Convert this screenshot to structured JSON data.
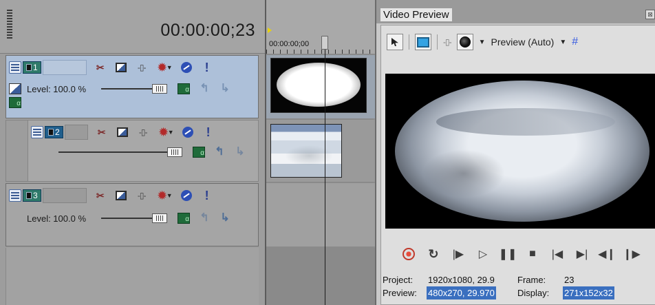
{
  "header": {
    "timecode": "00:00:00;23"
  },
  "tracks": [
    {
      "number": "1",
      "level_label": "Level: 100.0 %"
    },
    {
      "number": "2"
    },
    {
      "number": "3",
      "level_label": "Level: 100.0 %"
    }
  ],
  "timeline": {
    "ruler_time": "00:00:00;00"
  },
  "preview": {
    "title": "Video Preview",
    "close_glyph": "⊠",
    "quality_label": "Preview (Auto)",
    "info": {
      "project_label": "Project:",
      "project_value": "1920x1080, 29.9",
      "frame_label": "Frame:",
      "frame_value": "23",
      "preview_label": "Preview:",
      "preview_value": "480x270, 29.970",
      "display_label": "Display:",
      "display_value": "271x152x32"
    }
  },
  "colors": {
    "selected_track": "#adc0d9",
    "accent_blue": "#3a6fbf",
    "record_red": "#c0392b"
  }
}
